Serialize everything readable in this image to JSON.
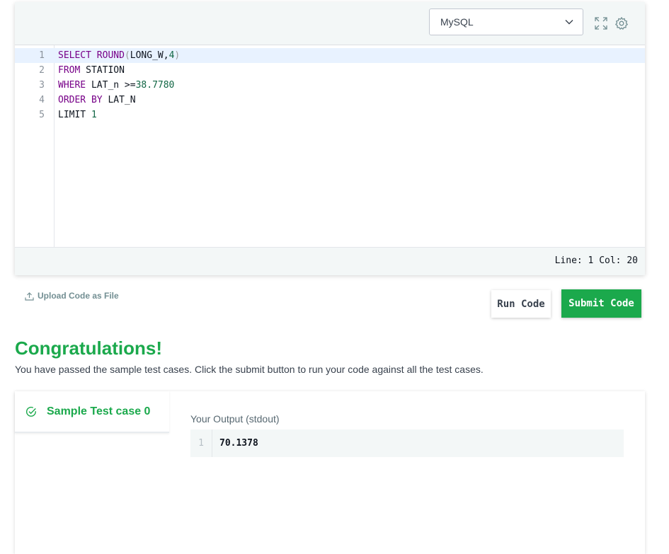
{
  "editor": {
    "language": "MySQL",
    "lines": [
      {
        "num": "1",
        "tokens": [
          {
            "t": "SELECT ",
            "c": "kw"
          },
          {
            "t": "ROUND",
            "c": "kw"
          },
          {
            "t": "(",
            "c": "paren"
          },
          {
            "t": "LONG_W,",
            "c": ""
          },
          {
            "t": "4",
            "c": "num"
          },
          {
            "t": ")",
            "c": "paren"
          }
        ]
      },
      {
        "num": "2",
        "tokens": [
          {
            "t": "FROM ",
            "c": "kw"
          },
          {
            "t": "STATION",
            "c": ""
          }
        ]
      },
      {
        "num": "3",
        "tokens": [
          {
            "t": "WHERE ",
            "c": "kw"
          },
          {
            "t": "LAT_n >=",
            "c": ""
          },
          {
            "t": "38.7780",
            "c": "num"
          }
        ]
      },
      {
        "num": "4",
        "tokens": [
          {
            "t": "ORDER BY ",
            "c": "kw"
          },
          {
            "t": "LAT_N",
            "c": ""
          }
        ]
      },
      {
        "num": "5",
        "tokens": [
          {
            "t": "LIMIT ",
            "c": ""
          },
          {
            "t": "1",
            "c": "num"
          }
        ]
      }
    ],
    "status": "Line: 1 Col: 20",
    "icons": [
      "fullscreen-icon",
      "settings-icon",
      "chevron-down-icon"
    ]
  },
  "actions": {
    "upload_label": "Upload Code as File",
    "run_label": "Run Code",
    "submit_label": "Submit Code"
  },
  "result": {
    "title": "Congratulations!",
    "message": "You have passed the sample test cases. Click the submit button to run your code against all the test cases.",
    "testcase_label": "Sample Test case 0",
    "output_label": "Your Output (stdout)",
    "output_line_num": "1",
    "output_value": "70.1378"
  },
  "colors": {
    "success": "#1ba94c",
    "keyword": "#770088",
    "number": "#116644"
  }
}
